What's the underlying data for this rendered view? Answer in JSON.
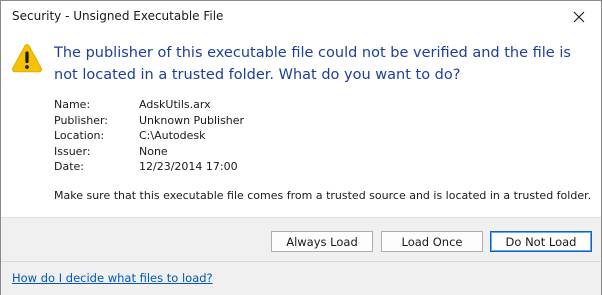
{
  "window": {
    "title": "Security - Unsigned Executable File",
    "close_icon": "close-icon"
  },
  "message": {
    "icon": "warning-icon",
    "icon_color": "#f5c200",
    "heading": "The publisher of this executable file could not be verified and the file is not located in a trusted folder. What do you want to do?",
    "heading_color": "#1d3f9b"
  },
  "details": [
    {
      "label": "Name:",
      "value": "AdskUtils.arx"
    },
    {
      "label": "Publisher:",
      "value": "Unknown Publisher"
    },
    {
      "label": "Location:",
      "value": "C:\\Autodesk"
    },
    {
      "label": "Issuer:",
      "value": "None"
    },
    {
      "label": "Date:",
      "value": "12/23/2014  17:00"
    }
  ],
  "note": "Make sure that this executable file comes from a trusted source and is located in a trusted folder.",
  "buttons": {
    "always_load": "Always Load",
    "load_once": "Load Once",
    "do_not_load": "Do Not Load"
  },
  "help_link": "How do I decide what files to load?"
}
